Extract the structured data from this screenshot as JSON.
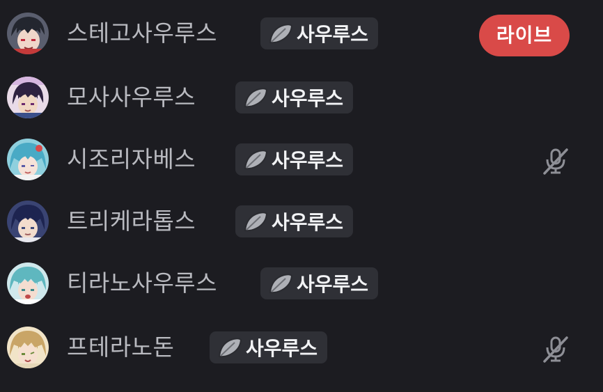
{
  "members": [
    {
      "name": "스테고사우루스",
      "tag": "사우루스",
      "tag_icon": "leaf-icon",
      "live": "라이브",
      "muted": false,
      "avatar_color": "#3b3f52"
    },
    {
      "name": "모사사우루스",
      "tag": "사우루스",
      "tag_icon": "leaf-icon",
      "muted": false,
      "avatar_color": "#3a2f4c"
    },
    {
      "name": "시조리자베스",
      "tag": "사우루스",
      "tag_icon": "leaf-icon",
      "muted": true,
      "avatar_color": "#4aa9c4"
    },
    {
      "name": "트리케라톱스",
      "tag": "사우루스",
      "tag_icon": "leaf-icon",
      "muted": false,
      "avatar_color": "#2b3768"
    },
    {
      "name": "티라노사우루스",
      "tag": "사우루스",
      "tag_icon": "leaf-icon",
      "muted": false,
      "avatar_color": "#5fb7bf"
    },
    {
      "name": "프테라노돈",
      "tag": "사우루스",
      "tag_icon": "leaf-icon",
      "muted": true,
      "avatar_color": "#c9a567"
    }
  ],
  "colors": {
    "background": "#1c1c21",
    "name_text": "#b9bac0",
    "tag_background": "#2f3036",
    "live_badge": "#d94a48",
    "mute_icon": "#8e8f96"
  }
}
